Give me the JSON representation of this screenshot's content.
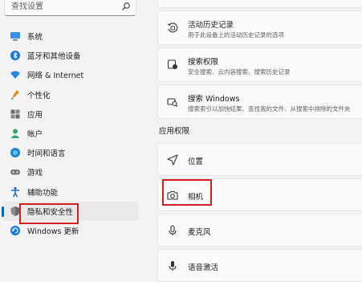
{
  "search": {
    "placeholder": "查找设置"
  },
  "sidebar": {
    "items": [
      {
        "label": "系统",
        "icon": "system-icon"
      },
      {
        "label": "蓝牙和其他设备",
        "icon": "bluetooth-icon"
      },
      {
        "label": "网络 & Internet",
        "icon": "network-icon"
      },
      {
        "label": "个性化",
        "icon": "personalization-icon"
      },
      {
        "label": "应用",
        "icon": "apps-icon"
      },
      {
        "label": "帐户",
        "icon": "account-icon"
      },
      {
        "label": "时间和语言",
        "icon": "time-language-icon"
      },
      {
        "label": "游戏",
        "icon": "gaming-icon"
      },
      {
        "label": "辅助功能",
        "icon": "accessibility-icon"
      },
      {
        "label": "隐私和安全性",
        "icon": "privacy-shield-icon",
        "active": true
      },
      {
        "label": "Windows 更新",
        "icon": "windows-update-icon"
      }
    ]
  },
  "main": {
    "cards": [
      {
        "title": "活动历史记录",
        "desc": "用于此设备上的活动历史记录的选项",
        "icon": "activity-history-icon"
      },
      {
        "title": "搜索权限",
        "desc": "安全搜索、云内容搜索、搜索历史记录",
        "icon": "search-permissions-icon"
      },
      {
        "title": "搜索 Windows",
        "desc": "搜索索引以加快结果、查找我的文件、从搜索中排除的文件夹",
        "icon": "search-windows-icon"
      }
    ],
    "section_title": "应用权限",
    "app_permissions": [
      {
        "title": "位置",
        "icon": "location-icon"
      },
      {
        "title": "相机",
        "icon": "camera-icon"
      },
      {
        "title": "麦克风",
        "icon": "microphone-icon"
      },
      {
        "title": "语音激活",
        "icon": "voice-activation-icon"
      }
    ]
  },
  "colors": {
    "accent": "#0067c0",
    "highlight_box": "#d21f1f",
    "background": "#f3f3f3",
    "card": "#fbfbfb"
  }
}
